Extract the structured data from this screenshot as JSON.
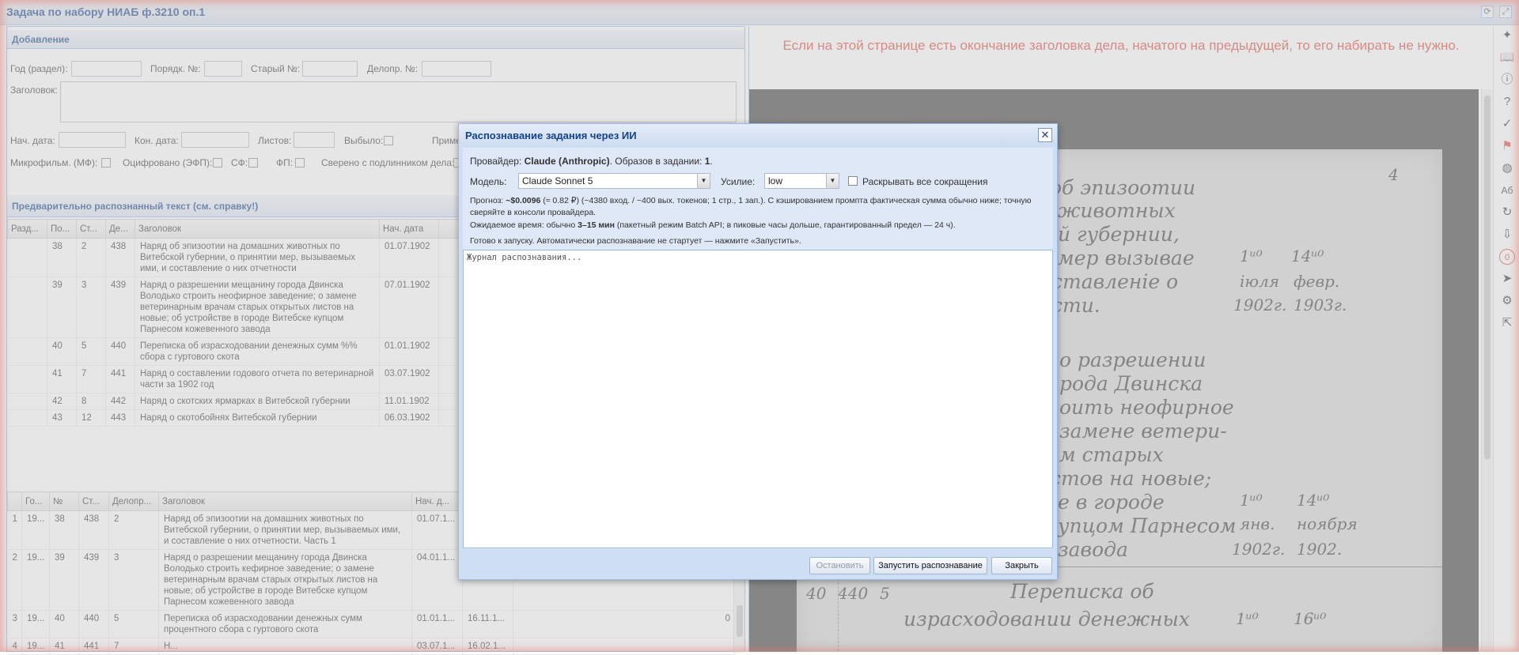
{
  "app": {
    "title": "Задача по набору НИАБ ф.3210 оп.1"
  },
  "add_panel": {
    "title": "Добавление",
    "year_label": "Год (раздел):",
    "order_label": "Порядк. №:",
    "old_label": "Старый №:",
    "delopr_label": "Делопр. №:",
    "heading_label": "Заголовок:",
    "start_date_label": "Нач. дата:",
    "end_date_label": "Кон. дата:",
    "sheets_label": "Листов:",
    "dropped_label": "Выбыло:",
    "note_label": "Примечание",
    "microfilm_label": "Микрофильм. (МФ):",
    "digitized_label": "Оцифровано (ЭФП):",
    "sf_label": "СФ:",
    "fp_label": "ФП:",
    "verified_label": "Сверено с подлинником дела:"
  },
  "recognized": {
    "title": "Предварительно распознанный текст (см. справку!)",
    "columns": [
      "Разд...",
      "По...",
      "Ст...",
      "Де...",
      "Заголовок",
      "Нач. дата"
    ],
    "rows": [
      [
        "",
        "38",
        "2",
        "438",
        "Наряд об эпизоотии на домашних животных по Витебской губернии, о принятии мер, вызываемых ими, и составление о них отчетности",
        "01.07.1902"
      ],
      [
        "",
        "39",
        "3",
        "439",
        "Наряд о разрешении мещанину города Двинска Володько строить неофирное заведение; о замене ветеринарным врачам старых открытых листов на новые; об устройстве в городе Витебске купцом Парнесом кожевенного завода",
        "07.01.1902"
      ],
      [
        "",
        "40",
        "5",
        "440",
        "Переписка об израсходовании денежных сумм %% сбора с гуртового скота",
        "01.01.1902"
      ],
      [
        "",
        "41",
        "7",
        "441",
        "Наряд о составлении годового отчета по ветеринарной части за 1902 год",
        "03.07.1902"
      ],
      [
        "",
        "42",
        "8",
        "442",
        "Наряд о скотских ярмарках в Витебской губернии",
        "11.01.1902"
      ],
      [
        "",
        "43",
        "12",
        "443",
        "Наряд о скотобойнях Витебской губернии",
        "06.03.1902"
      ]
    ]
  },
  "lower_table": {
    "columns": [
      "",
      "Го...",
      "№",
      "Ст...",
      "Делопр...",
      "Заголовок",
      "Нач. д...",
      "",
      ""
    ],
    "rows": [
      [
        "1",
        "19...",
        "38",
        "438",
        "2",
        "Наряд об эпизоотии на домашних животных по Витебской губернии, о принятии мер, вызываемых ими, и составление о них отчетности. Часть 1",
        "01.07.1...",
        "",
        ""
      ],
      [
        "2",
        "19...",
        "39",
        "439",
        "3",
        "Наряд о разрешении мещанину города Двинска Володько строить кефирное заведение; о замене ветеринарным врачам старых открытых листов на новые; об устройстве в городе Витебске купцом Парнесом кожевенного завода",
        "04.01.1...",
        "",
        ""
      ],
      [
        "3",
        "19...",
        "40",
        "440",
        "5",
        "Переписка об израсходовании денежных сумм процентного сбора с гуртового скота",
        "01.01.1...",
        "16.11.1...",
        "0"
      ],
      [
        "4",
        "19...",
        "41",
        "441",
        "7",
        "Н...",
        "03.07.1...",
        "16.02.1...",
        ""
      ]
    ]
  },
  "notice": "Если на этой странице есть окончание заголовка дела, начатого на предыдущей, то его набирать не нужно.",
  "scan": {
    "lines": [
      "об эпизоотии",
      "животных",
      "й губернии,",
      "мер вызывае",
      "ставленiе о",
      "сти.",
      "о разрешении",
      "рода Двинска",
      "оить неофирное",
      "замене ветери-",
      "м старых",
      "стов на новые;",
      "е в городе",
      "упцом Парнесом",
      "завода",
      "Переписка об",
      "израсходовании денежных"
    ],
    "dates": [
      "1ᵘ⁰",
      "14ᵘ⁰",
      "iюля",
      "февр.",
      "1902г.",
      "1903г.",
      "1ᵘ⁰",
      "14ᵘ⁰",
      "янв.",
      "ноября",
      "1902г.",
      "1902.",
      "1ᵘ⁰",
      "16ᵘ⁰"
    ],
    "margin": [
      "40",
      "440",
      "5",
      "4"
    ]
  },
  "toolbar": {
    "icons": [
      "sparkle-icon",
      "book-icon",
      "info-icon",
      "help-icon",
      "check-circle-icon",
      "flag-icon",
      "globe-icon",
      "translate-icon",
      "rotate-icon",
      "download-icon",
      "chat-icon",
      "send-icon",
      "settings-icon",
      "exit-icon"
    ],
    "chat_count": "0"
  },
  "modal": {
    "title": "Распознавание задания через ИИ",
    "provider_prefix": "Провайдер: ",
    "provider_name": "Claude (Anthropic)",
    "samples_text": ". Образов в задании: ",
    "samples_count": "1",
    "samples_end": ".",
    "model_label": "Модель:",
    "model_value": "Claude Sonnet 5",
    "effort_label": "Усилие:",
    "effort_value": "low",
    "expand_label": "Раскрывать все сокращения",
    "forecast_prefix": "Прогноз: ",
    "forecast_cost": "~$0.0096",
    "forecast_rest": " (≈ 0.82 ₽) (~4380 вход. / ~400 вых. токенов; 1 стр., 1 зап.). С кэшированием промпта фактическая сумма обычно ниже; точную сверяйте в консоли провайдера.",
    "time_prefix": "Ожидаемое время: обычно ",
    "time_value": "3–15 мин",
    "time_rest": " (пакетный режим Batch API; в пиковые часы дольше, гарантированный предел — 24 ч).",
    "ready_text": "Готово к запуску. Автоматически распознавание не стартует — нажмите «Запустить».",
    "log_placeholder": "Журнал распознавания...",
    "stop_label": "Остановить",
    "start_label": "Запустить распознавание",
    "close_label": "Закрыть"
  }
}
